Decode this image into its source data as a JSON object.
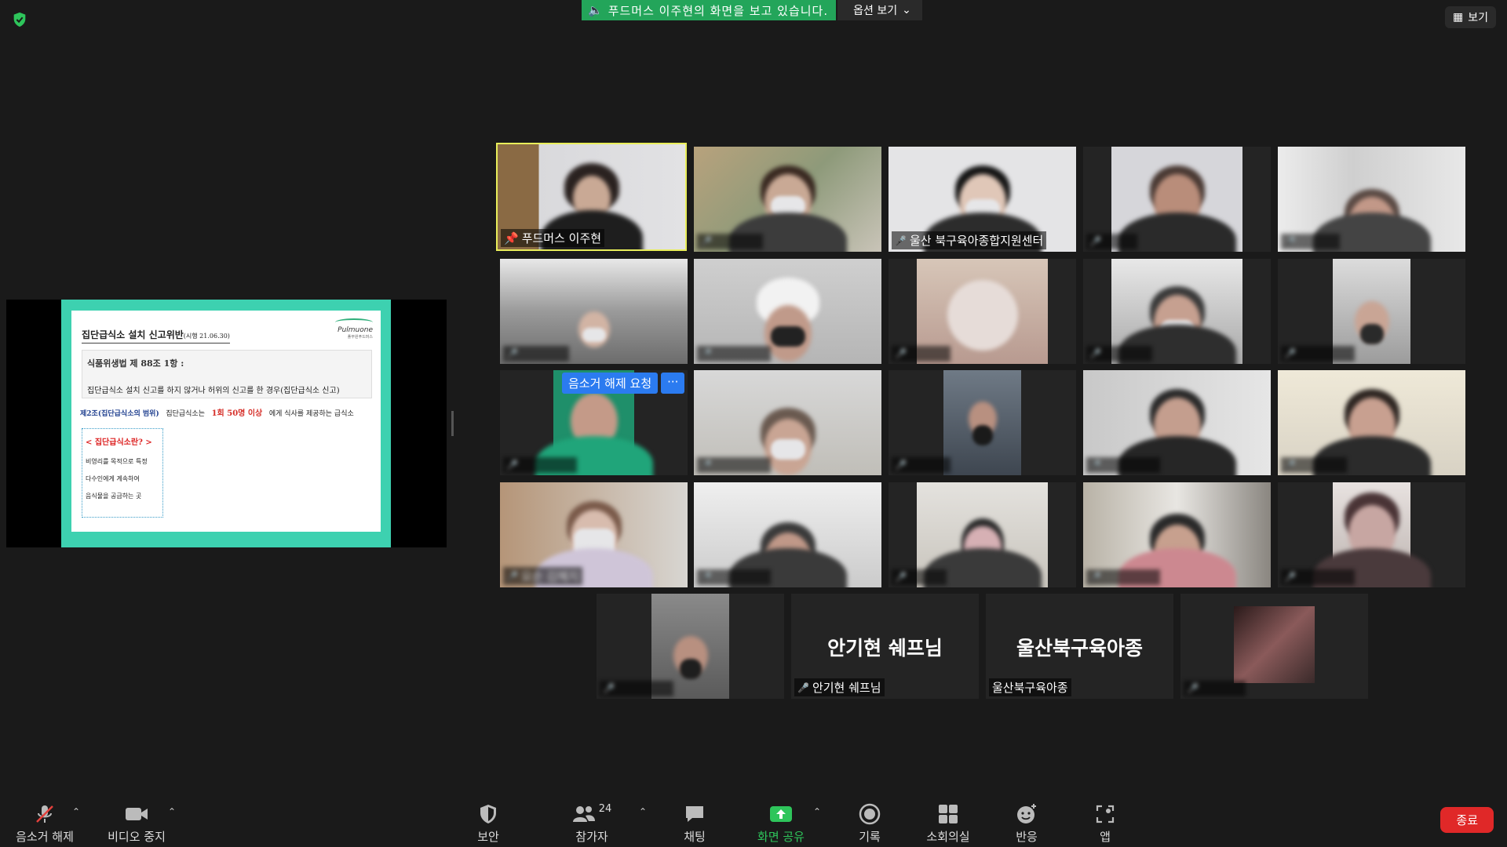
{
  "banner": {
    "text": "푸드머스 이주현의 화면을 보고 있습니다.",
    "options_label": "옵션 보기"
  },
  "view_button": {
    "label": "보기"
  },
  "slide": {
    "title": "집단급식소 설치 신고위반",
    "title_note": "(시행 21.06.30)",
    "logo": "Pulmuone",
    "logo_sub": "풀무원푸드머스",
    "law": "식품위생법 제 88조 1항 :",
    "line": "집단급식소 설치 신고를 하지 않거나 허위의 신고를 한 경우(집단급식소 신고)",
    "row_scope": "제2조(집단급식소의 범위)",
    "row_middle": "집단급식소는",
    "row_highlight": "1회 50명 이상",
    "row_end": "에게 식사를 제공하는 급식소",
    "box_heading": "< 집단급식소란? >",
    "box_lines": [
      "비영리를 목적으로 특정",
      "다수인에게 계속하여",
      "음식물을 공급하는 곳"
    ]
  },
  "unmute_request": {
    "label": "음소거 해제 요청",
    "more": "···"
  },
  "participants": [
    {
      "name": "푸드머스 이주현",
      "blurred": false,
      "pinned": true
    },
    {
      "name": "울산 북구육아종합지원센터",
      "blurred": false
    },
    {
      "name": "요순 김혜지",
      "blurred": true
    },
    {
      "name": "안기현 쉐프님",
      "blurred": false,
      "big": "안기현 쉐프님"
    },
    {
      "name": "울산북구육아종",
      "blurred": false,
      "big": "울산북구육아종"
    },
    {
      "name": "참가자",
      "blurred": true
    }
  ],
  "toolbar": {
    "mute": "음소거 해제",
    "video": "비디오 중지",
    "security": "보안",
    "participants": "참가자",
    "participants_count": "24",
    "chat": "채팅",
    "share": "화면 공유",
    "record": "기록",
    "breakout": "소회의실",
    "reactions": "반응",
    "apps": "앱",
    "end": "종료"
  },
  "colors": {
    "share_green": "#23a55a",
    "speaker_outline": "#e9ee5a",
    "end_red": "#e02828",
    "slide_teal": "#3dd1b0"
  }
}
